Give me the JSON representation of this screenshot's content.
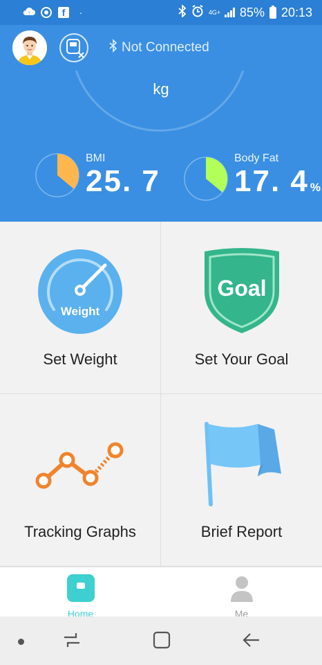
{
  "status_bar": {
    "battery": "85%",
    "time": "20:13",
    "network": "4G+",
    "icons": [
      "cloud-icon",
      "sync-icon",
      "facebook-icon",
      "dot-icon",
      "bluetooth-icon",
      "alarm-icon",
      "signal-icon",
      "battery-icon"
    ]
  },
  "header": {
    "connection_status": "Not Connected",
    "icons": [
      "avatar",
      "scale-disconnected-icon",
      "bluetooth-icon"
    ]
  },
  "hero": {
    "unit": "kg",
    "bmi": {
      "label": "BMI",
      "value": "25. 7",
      "fill_fraction": 0.36,
      "color": "#ffb74d"
    },
    "body_fat": {
      "label": "Body Fat",
      "value": "17. 4",
      "unit": "%",
      "fill_fraction": 0.36,
      "color": "#b2ff59"
    }
  },
  "tiles": [
    {
      "label": "Set Weight",
      "icon": "weight-gauge-icon",
      "icon_text": "Weight"
    },
    {
      "label": "Set Your Goal",
      "icon": "goal-shield-icon",
      "icon_text": "Goal"
    },
    {
      "label": "Tracking Graphs",
      "icon": "tracking-graph-icon"
    },
    {
      "label": "Brief Report",
      "icon": "flag-icon"
    }
  ],
  "bottom_nav": {
    "home": "Home",
    "me": "Me",
    "active": "Home",
    "active_color": "#3ecfd1",
    "inactive_color": "#9e9e9e"
  },
  "system_nav": {
    "icons": [
      "dot-icon",
      "recents-icon",
      "home-icon",
      "back-icon"
    ]
  },
  "colors": {
    "primary": "#3a8fe2",
    "status_bar": "#2b7fd4",
    "weight_icon": "#5ab1ee",
    "goal_icon": "#34b58b",
    "graph_icon": "#f0842c",
    "flag_icon": "#6ec1f6"
  }
}
